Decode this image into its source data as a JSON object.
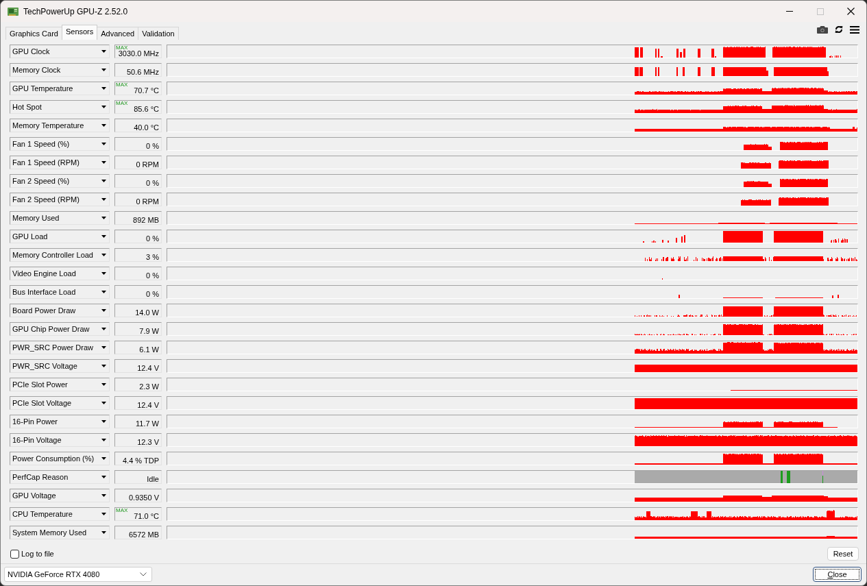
{
  "window": {
    "title": "TechPowerUp GPU-Z 2.52.0",
    "maximize": {
      "disabled": true
    }
  },
  "tabs": [
    {
      "label": "Graphics Card",
      "selected": false
    },
    {
      "label": "Sensors",
      "selected": true
    },
    {
      "label": "Advanced",
      "selected": false
    },
    {
      "label": "Validation",
      "selected": false
    }
  ],
  "sensors": [
    {
      "kind": "plot",
      "name": "GPU Clock",
      "value": "3030.0 MHz",
      "max_label": "MAX"
    },
    {
      "kind": "plot",
      "name": "Memory Clock",
      "value": "50.6 MHz"
    },
    {
      "kind": "plot",
      "name": "GPU Temperature",
      "value": "70.7 °C",
      "max_label": "MAX"
    },
    {
      "kind": "plot",
      "name": "Hot Spot",
      "value": "85.6 °C",
      "max_label": "MAX"
    },
    {
      "kind": "plot",
      "name": "Memory Temperature",
      "value": "40.0 °C"
    },
    {
      "kind": "plot",
      "name": "Fan 1 Speed (%)",
      "value": "0 %"
    },
    {
      "kind": "plot",
      "name": "Fan 1 Speed (RPM)",
      "value": "0 RPM"
    },
    {
      "kind": "plot",
      "name": "Fan 2 Speed (%)",
      "value": "0 %"
    },
    {
      "kind": "plot",
      "name": "Fan 2 Speed (RPM)",
      "value": "0 RPM"
    },
    {
      "kind": "plot",
      "name": "Memory Used",
      "value": "892 MB"
    },
    {
      "kind": "plot",
      "name": "GPU Load",
      "value": "0 %"
    },
    {
      "kind": "plot",
      "name": "Memory Controller Load",
      "value": "3 %"
    },
    {
      "kind": "plot",
      "name": "Video Engine Load",
      "value": "0 %"
    },
    {
      "kind": "plot",
      "name": "Bus Interface Load",
      "value": "0 %"
    },
    {
      "kind": "plot",
      "name": "Board Power Draw",
      "value": "14.0 W"
    },
    {
      "kind": "plot",
      "name": "GPU Chip Power Draw",
      "value": "7.9 W"
    },
    {
      "kind": "plot",
      "name": "PWR_SRC Power Draw",
      "value": "6.1 W"
    },
    {
      "kind": "plot",
      "name": "PWR_SRC Voltage",
      "value": "12.4 V"
    },
    {
      "kind": "plot",
      "name": "PCIe Slot Power",
      "value": "2.3 W"
    },
    {
      "kind": "plot",
      "name": "PCIe Slot Voltage",
      "value": "12.4 V"
    },
    {
      "kind": "plot",
      "name": "16-Pin Power",
      "value": "11.7 W"
    },
    {
      "kind": "plot",
      "name": "16-Pin Voltage",
      "value": "12.3 V"
    },
    {
      "kind": "plot",
      "name": "Power Consumption (%)",
      "value": "4.4 % TDP"
    },
    {
      "kind": "status",
      "name": "PerfCap Reason",
      "value": "Idle"
    },
    {
      "kind": "plot",
      "name": "GPU Voltage",
      "value": "0.9350 V"
    },
    {
      "kind": "plot",
      "name": "CPU Temperature",
      "value": "71.0 °C",
      "max_label": "MAX"
    },
    {
      "kind": "plot",
      "name": "System Memory Used",
      "value": "6572 MB"
    }
  ],
  "log_to_file": {
    "label": "Log to file",
    "checked": false
  },
  "reset_button": {
    "label": "Reset"
  },
  "device_select": {
    "value": "NVIDIA GeForce RTX 4080"
  },
  "close_button": {
    "label": "Close",
    "focused": true
  }
}
